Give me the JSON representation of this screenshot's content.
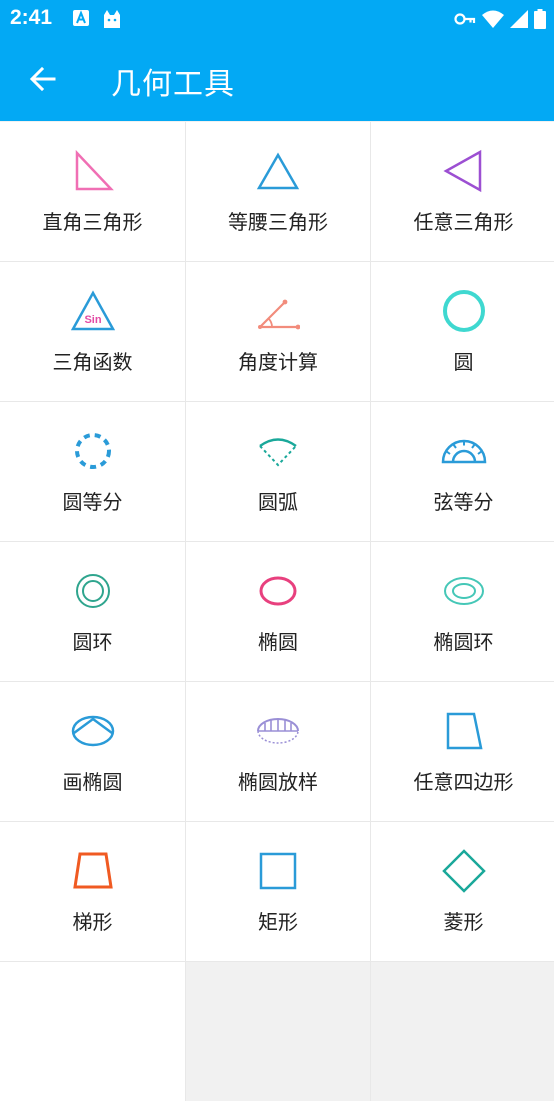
{
  "status_bar": {
    "time": "2:41",
    "left_icons": [
      "a-notification-icon",
      "cat-notification-icon"
    ],
    "right_icons": [
      "vpn-key-icon",
      "wifi-icon",
      "cellular-icon",
      "battery-icon"
    ]
  },
  "app_bar": {
    "back_icon": "arrow-left-icon",
    "title": "几何工具"
  },
  "tools": [
    {
      "label": "直角三角形",
      "icon": "right-triangle-icon",
      "color": "#f06fb4"
    },
    {
      "label": "等腰三角形",
      "icon": "isosceles-triangle-icon",
      "color": "#2a9bd8"
    },
    {
      "label": "任意三角形",
      "icon": "arbitrary-triangle-icon",
      "color": "#9c4fd2"
    },
    {
      "label": "三角函数",
      "icon": "sin-triangle-icon",
      "color": "#2a9bd8",
      "icon_text": "Sin"
    },
    {
      "label": "角度计算",
      "icon": "angle-icon",
      "color": "#f28c7c"
    },
    {
      "label": "圆",
      "icon": "circle-icon",
      "color": "#3fd8d0"
    },
    {
      "label": "圆等分",
      "icon": "dashed-circle-icon",
      "color": "#2a9bd8"
    },
    {
      "label": "圆弧",
      "icon": "arc-sector-icon",
      "color": "#1aa89a"
    },
    {
      "label": "弦等分",
      "icon": "protractor-icon",
      "color": "#2a9bd8"
    },
    {
      "label": "圆环",
      "icon": "ring-icon",
      "color": "#2fa58e"
    },
    {
      "label": "椭圆",
      "icon": "ellipse-icon",
      "color": "#e8407e"
    },
    {
      "label": "椭圆环",
      "icon": "ellipse-ring-icon",
      "color": "#45c7b7"
    },
    {
      "label": "画椭圆",
      "icon": "draw-ellipse-icon",
      "color": "#2a9bd8"
    },
    {
      "label": "椭圆放样",
      "icon": "ellipse-lofting-icon",
      "color": "#9a8fd6"
    },
    {
      "label": "任意四边形",
      "icon": "quadrilateral-icon",
      "color": "#2a9bd8"
    },
    {
      "label": "梯形",
      "icon": "trapezoid-icon",
      "color": "#f05a22"
    },
    {
      "label": "矩形",
      "icon": "square-icon",
      "color": "#2a9bd8"
    },
    {
      "label": "菱形",
      "icon": "rhombus-icon",
      "color": "#1aa89a"
    }
  ]
}
